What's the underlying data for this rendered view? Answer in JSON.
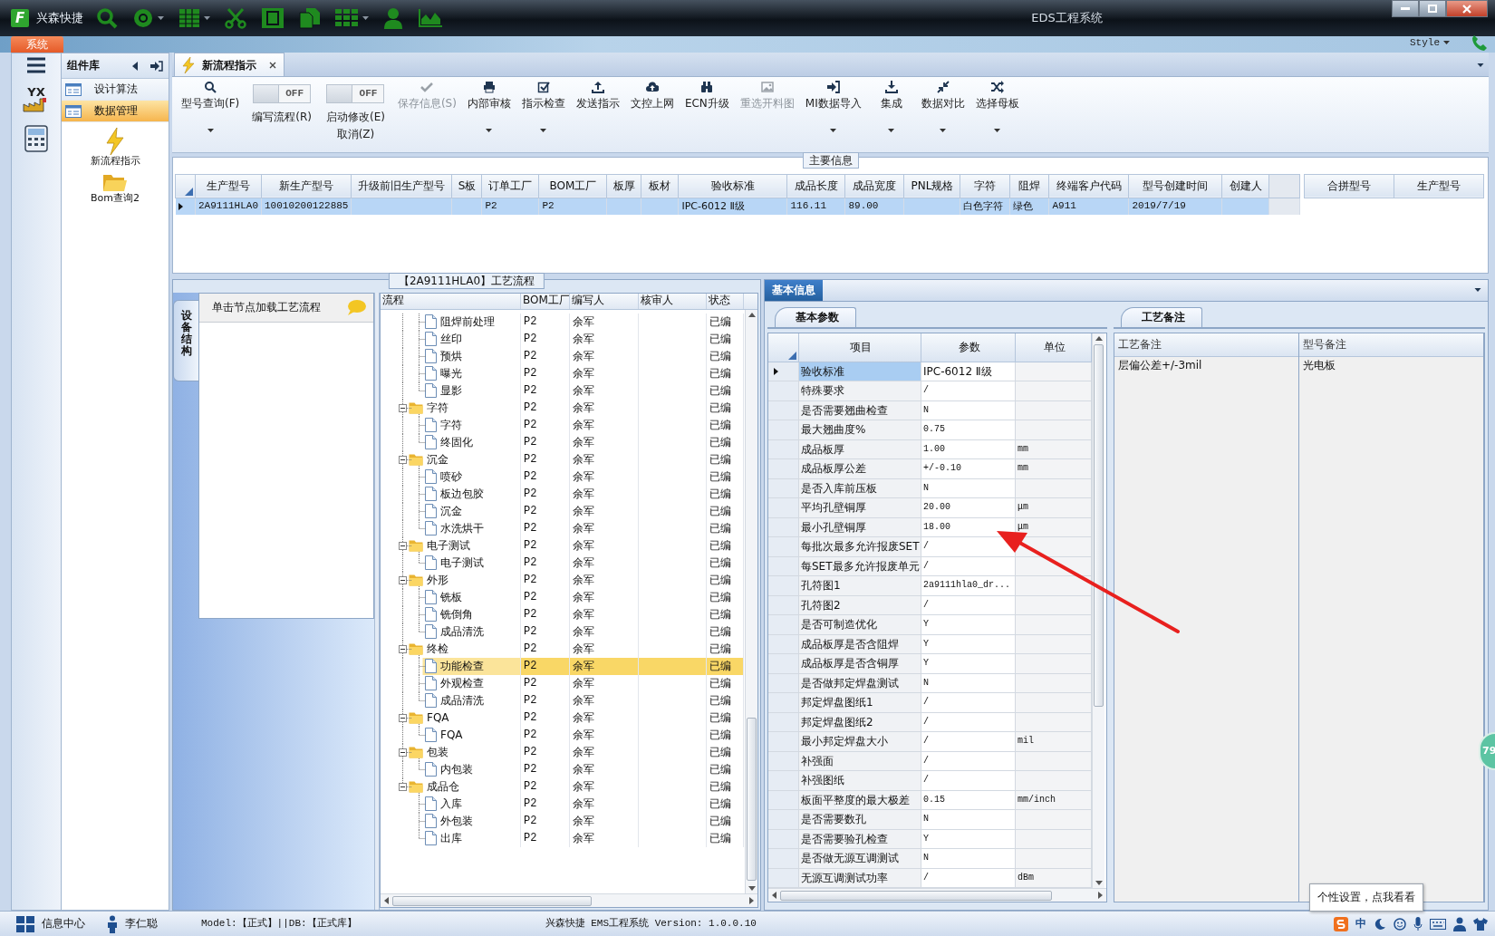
{
  "title_bar": {
    "logo": "F",
    "app_name": "兴森快捷",
    "title": "EDS工程系统"
  },
  "ribbon": {
    "menu_tab": "系统",
    "style_label": "Style"
  },
  "left_strip": {
    "logo_text": "YX"
  },
  "sidebar": {
    "title": "组件库",
    "items": [
      {
        "label": "设计算法",
        "selected": false
      },
      {
        "label": "数据管理",
        "selected": true
      }
    ],
    "tiles": [
      {
        "label": "新流程指示"
      },
      {
        "label": "Bom查询2"
      }
    ]
  },
  "document_tabs": [
    {
      "label": "新流程指示",
      "selected": true
    }
  ],
  "toolbar": [
    {
      "kind": "button",
      "label": "型号查询(F)",
      "disabled": false,
      "dropdown": true
    },
    {
      "kind": "toggle",
      "label": "编写流程(R)",
      "on": false,
      "switch_text": "OFF"
    },
    {
      "kind": "toggle",
      "label": "启动修改(E)",
      "second_label": "取消(Z)",
      "on": false,
      "switch_text": "OFF"
    },
    {
      "kind": "button",
      "label": "保存信息(S)",
      "disabled": true,
      "dropdown": false
    },
    {
      "kind": "button",
      "label": "内部审核",
      "disabled": false,
      "dropdown": true
    },
    {
      "kind": "button",
      "label": "指示检查",
      "disabled": false,
      "dropdown": true
    },
    {
      "kind": "button",
      "label": "发送指示",
      "disabled": false,
      "dropdown": false
    },
    {
      "kind": "button",
      "label": "文控上网",
      "disabled": false,
      "dropdown": false
    },
    {
      "kind": "button",
      "label": "ECN升级",
      "disabled": false,
      "dropdown": false
    },
    {
      "kind": "button",
      "label": "重选开料图",
      "disabled": true,
      "dropdown": false
    },
    {
      "kind": "button",
      "label": "MI数据导入",
      "disabled": false,
      "dropdown": true
    },
    {
      "kind": "button",
      "label": "集成",
      "disabled": false,
      "dropdown": true
    },
    {
      "kind": "button",
      "label": "数据对比",
      "disabled": false,
      "dropdown": true
    },
    {
      "kind": "button",
      "label": "选择母板",
      "disabled": false,
      "dropdown": true
    }
  ],
  "main_info": {
    "title": "主要信息",
    "columns": [
      "生产型号",
      "新生产型号",
      "升级前旧生产型号",
      "S板",
      "订单工厂",
      "BOM工厂",
      "板厚",
      "板材",
      "验收标准",
      "成品长度",
      "成品宽度",
      "PNL规格",
      "字符",
      "阻焊",
      "终端客户代码",
      "型号创建时间",
      "创建人"
    ],
    "rows": [
      {
        "selected": true,
        "cells": [
          "2A9111HLA0",
          "10010200122885",
          null,
          null,
          "P2",
          "P2",
          null,
          null,
          "IPC-6012 Ⅱ级",
          "116.11",
          "89.00",
          null,
          "白色字符",
          "绿色",
          "A911",
          "2019/7/19",
          null
        ]
      }
    ],
    "merge_columns": [
      "合拼型号",
      "生产型号"
    ]
  },
  "process": {
    "title": "【2A9111HLA0】工艺流程",
    "side_tab": "设备结构",
    "hint": "单击节点加载工艺流程",
    "columns": [
      "流程",
      "BOM工厂",
      "编写人",
      "核审人",
      "状态"
    ],
    "rows": [
      {
        "kind": "file",
        "label": "阻焊前处理",
        "bom": "P2",
        "writer": "余军",
        "status": "已编",
        "selected": false
      },
      {
        "kind": "file",
        "label": "丝印",
        "bom": "P2",
        "writer": "余军",
        "status": "已编",
        "selected": false
      },
      {
        "kind": "file",
        "label": "预烘",
        "bom": "P2",
        "writer": "余军",
        "status": "已编",
        "selected": false
      },
      {
        "kind": "file",
        "label": "曝光",
        "bom": "P2",
        "writer": "余军",
        "status": "已编",
        "selected": false
      },
      {
        "kind": "file",
        "label": "显影",
        "bom": "P2",
        "writer": "余军",
        "status": "已编",
        "selected": false
      },
      {
        "kind": "folder",
        "label": "字符",
        "bom": "P2",
        "writer": "余军",
        "status": "已编",
        "selected": false,
        "expanded": true,
        "children": [
          {
            "kind": "file",
            "label": "字符",
            "bom": "P2",
            "writer": "余军",
            "status": "已编",
            "selected": false
          },
          {
            "kind": "file",
            "label": "终固化",
            "bom": "P2",
            "writer": "余军",
            "status": "已编",
            "selected": false
          }
        ]
      },
      {
        "kind": "folder",
        "label": "沉金",
        "bom": "P2",
        "writer": "余军",
        "status": "已编",
        "selected": false,
        "expanded": true,
        "children": [
          {
            "kind": "file",
            "label": "喷砂",
            "bom": "P2",
            "writer": "余军",
            "status": "已编",
            "selected": false
          },
          {
            "kind": "file",
            "label": "板边包胶",
            "bom": "P2",
            "writer": "余军",
            "status": "已编",
            "selected": false
          },
          {
            "kind": "file",
            "label": "沉金",
            "bom": "P2",
            "writer": "余军",
            "status": "已编",
            "selected": false
          },
          {
            "kind": "file",
            "label": "水洗烘干",
            "bom": "P2",
            "writer": "余军",
            "status": "已编",
            "selected": false
          }
        ]
      },
      {
        "kind": "folder",
        "label": "电子测试",
        "bom": "P2",
        "writer": "余军",
        "status": "已编",
        "selected": false,
        "expanded": true,
        "children": [
          {
            "kind": "file",
            "label": "电子测试",
            "bom": "P2",
            "writer": "余军",
            "status": "已编",
            "selected": false
          }
        ]
      },
      {
        "kind": "folder",
        "label": "外形",
        "bom": "P2",
        "writer": "余军",
        "status": "已编",
        "selected": false,
        "expanded": true,
        "children": [
          {
            "kind": "file",
            "label": "铣板",
            "bom": "P2",
            "writer": "余军",
            "status": "已编",
            "selected": false
          },
          {
            "kind": "file",
            "label": "铣倒角",
            "bom": "P2",
            "writer": "余军",
            "status": "已编",
            "selected": false
          },
          {
            "kind": "file",
            "label": "成品清洗",
            "bom": "P2",
            "writer": "余军",
            "status": "已编",
            "selected": false
          }
        ]
      },
      {
        "kind": "folder",
        "label": "终检",
        "bom": "P2",
        "writer": "余军",
        "status": "已编",
        "selected": false,
        "expanded": true,
        "children": [
          {
            "kind": "file",
            "label": "功能检查",
            "bom": "P2",
            "writer": "余军",
            "status": "已编",
            "selected": true
          },
          {
            "kind": "file",
            "label": "外观检查",
            "bom": "P2",
            "writer": "余军",
            "status": "已编",
            "selected": false
          },
          {
            "kind": "file",
            "label": "成品清洗",
            "bom": "P2",
            "writer": "余军",
            "status": "已编",
            "selected": false
          }
        ]
      },
      {
        "kind": "folder",
        "label": "FQA",
        "bom": "P2",
        "writer": "余军",
        "status": "已编",
        "selected": false,
        "expanded": true,
        "children": [
          {
            "kind": "file",
            "label": "FQA",
            "bom": "P2",
            "writer": "余军",
            "status": "已编",
            "selected": false
          }
        ]
      },
      {
        "kind": "folder",
        "label": "包装",
        "bom": "P2",
        "writer": "余军",
        "status": "已编",
        "selected": false,
        "expanded": true,
        "children": [
          {
            "kind": "file",
            "label": "内包装",
            "bom": "P2",
            "writer": "余军",
            "status": "已编",
            "selected": false
          }
        ]
      },
      {
        "kind": "folder",
        "label": "成品仓",
        "bom": "P2",
        "writer": "余军",
        "status": "已编",
        "selected": false,
        "expanded": true,
        "children": [
          {
            "kind": "file",
            "label": "入库",
            "bom": "P2",
            "writer": "余军",
            "status": "已编",
            "selected": false
          },
          {
            "kind": "file",
            "label": "外包装",
            "bom": "P2",
            "writer": "余军",
            "status": "已编",
            "selected": false
          },
          {
            "kind": "file",
            "label": "出库",
            "bom": "P2",
            "writer": "余军",
            "status": "已编",
            "selected": false
          }
        ]
      }
    ]
  },
  "details": {
    "tab": "基本信息",
    "params_tab": "基本参数",
    "columns": [
      "项目",
      "参数",
      "单位"
    ],
    "rows": [
      {
        "item": "验收标准",
        "value": "IPC-6012 Ⅱ级",
        "selected": true
      },
      {
        "item": "特殊要求",
        "value": "/",
        "selected": false
      },
      {
        "item": "是否需要翘曲检查",
        "value": "N",
        "selected": false
      },
      {
        "item": "最大翘曲度%",
        "value": "0.75",
        "selected": false
      },
      {
        "item": "成品板厚",
        "value": "1.00",
        "unit": "mm",
        "selected": false
      },
      {
        "item": "成品板厚公差",
        "value": "+/-0.10",
        "unit": "mm",
        "selected": false
      },
      {
        "item": "是否入库前压板",
        "value": "N",
        "selected": false
      },
      {
        "item": "平均孔壁铜厚",
        "value": "20.00",
        "unit": "μm",
        "selected": false
      },
      {
        "item": "最小孔壁铜厚",
        "value": "18.00",
        "unit": "μm",
        "selected": false
      },
      {
        "item": "每批次最多允许报废SET",
        "value": "/",
        "selected": false
      },
      {
        "item": "每SET最多允许报废单元",
        "value": "/",
        "selected": false
      },
      {
        "item": "孔符图1",
        "value": "2a9111hla0_dr...",
        "selected": false
      },
      {
        "item": "孔符图2",
        "value": "/",
        "selected": false
      },
      {
        "item": "是否可制造优化",
        "value": "Y",
        "selected": false
      },
      {
        "item": "成品板厚是否含阻焊",
        "value": "Y",
        "selected": false
      },
      {
        "item": "成品板厚是否含铜厚",
        "value": "Y",
        "selected": false
      },
      {
        "item": "是否做邦定焊盘测试",
        "value": "N",
        "selected": false
      },
      {
        "item": "邦定焊盘图纸1",
        "value": "/",
        "selected": false
      },
      {
        "item": "邦定焊盘图纸2",
        "value": "/",
        "selected": false
      },
      {
        "item": "最小邦定焊盘大小",
        "value": "/",
        "unit": "mil",
        "selected": false
      },
      {
        "item": "补强面",
        "value": "/",
        "selected": false
      },
      {
        "item": "补强图纸",
        "value": "/",
        "selected": false
      },
      {
        "item": "板面平整度的最大极差",
        "value": "0.15",
        "unit": "mm/inch",
        "selected": false
      },
      {
        "item": "是否需要数孔",
        "value": "N",
        "selected": false
      },
      {
        "item": "是否需要验孔检查",
        "value": "Y",
        "selected": false
      },
      {
        "item": "是否做无源互调测试",
        "value": "N",
        "selected": false
      },
      {
        "item": "无源互调测试功率",
        "value": "/",
        "unit": "dBm",
        "selected": false
      }
    ],
    "notes_tab": "工艺备注",
    "notes_columns": [
      "工艺备注",
      "型号备注"
    ],
    "notes": [
      "层偏公差+/-3mil",
      "光电板"
    ]
  },
  "status_bar": {
    "items": [
      {
        "label": "信息中心"
      },
      {
        "label": "李仁聪"
      }
    ],
    "connection": "Model:【正式】||DB:【正式库】",
    "version": "兴森快捷 EMS工程系统 Version: 1.0.0.10",
    "ime": "中"
  },
  "tooltip": "个性设置，点我看看",
  "side_badge": "79"
}
